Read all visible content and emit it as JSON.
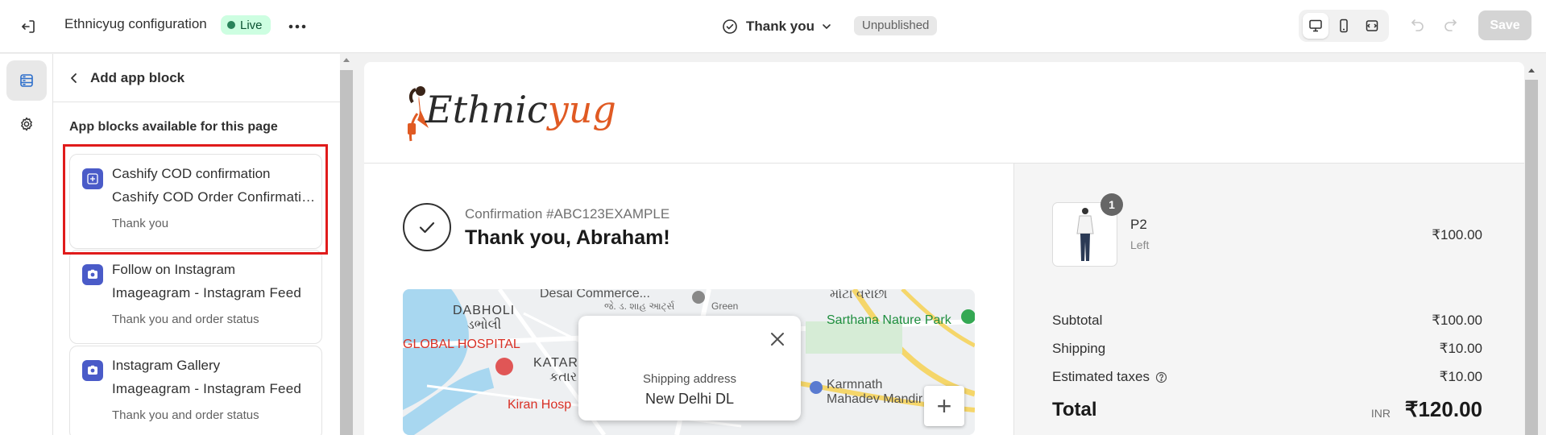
{
  "topbar": {
    "store_name": "Ethnicyug configuration",
    "status": "Live",
    "page_name": "Thank you",
    "publish_state": "Unpublished",
    "save_label": "Save"
  },
  "panel": {
    "title": "Add app block",
    "section_title": "App blocks available for this page",
    "blocks": [
      {
        "title": "Cashify COD confirmation",
        "app": "Cashify COD Order Confirmation",
        "pages": "Thank you"
      },
      {
        "title": "Follow on Instagram",
        "app": "Imageagram - Instagram Feed",
        "pages": "Thank you and order status"
      },
      {
        "title": "Instagram Gallery",
        "app": "Imageagram - Instagram Feed",
        "pages": "Thank you and order status"
      }
    ]
  },
  "preview": {
    "logo": {
      "text_main": "Ethnic",
      "text_accent": "yug"
    },
    "confirmation": "Confirmation #ABC123EXAMPLE",
    "thanks": "Thank you, Abraham!",
    "map": {
      "popup_label": "Shipping address",
      "popup_address": "New Delhi DL",
      "labels": {
        "desai": "Desai Commerce...",
        "desai_guj": "જે. ડ. શાહ આર્ટ્સ",
        "green": "Green",
        "mota": "મોટા વરાછા",
        "sarthana": "Sarthana Nature Park",
        "dabholi": "DABHOLI",
        "dabholi_guj": "ડભોલી",
        "global": "GLOBAL HOSPITAL",
        "katar": "KATAR",
        "katar_guj": "કતાર",
        "kiran": "Kiran Hosp",
        "karmnath": "Karmnath",
        "mahadev": "Mahadev Mandir"
      },
      "zoom_in": "+"
    },
    "product": {
      "qty": "1",
      "name": "P2",
      "variant": "Left",
      "price": "₹100.00"
    },
    "summary": {
      "subtotal_label": "Subtotal",
      "subtotal": "₹100.00",
      "shipping_label": "Shipping",
      "shipping": "₹10.00",
      "taxes_label": "Estimated taxes",
      "taxes": "₹10.00",
      "total_label": "Total",
      "currency": "INR",
      "total": "₹120.00"
    }
  }
}
